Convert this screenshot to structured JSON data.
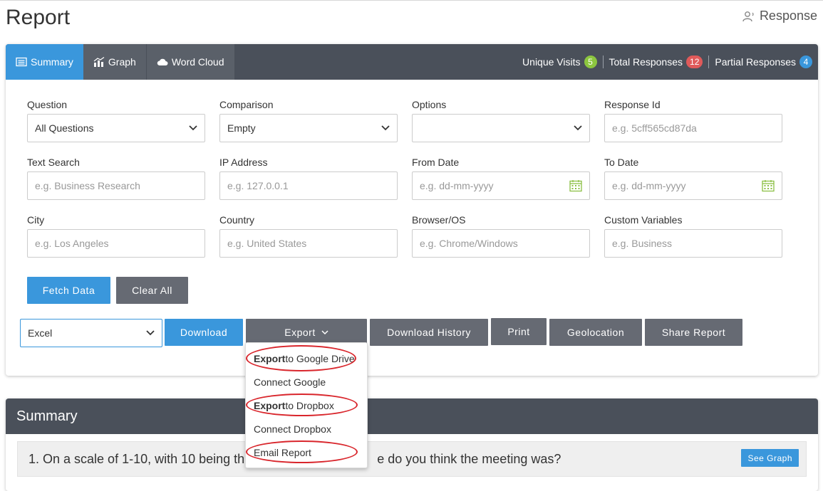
{
  "page": {
    "title": "Report",
    "response_link": "Response"
  },
  "tabs": [
    {
      "label": "Summary",
      "icon": "list-icon",
      "active": true
    },
    {
      "label": "Graph",
      "icon": "bar-chart-icon",
      "active": false
    },
    {
      "label": "Word Cloud",
      "icon": "cloud-icon",
      "active": false
    }
  ],
  "stats": {
    "unique_visits": {
      "label": "Unique Visits",
      "value": "5"
    },
    "total_responses": {
      "label": "Total Responses",
      "value": "12"
    },
    "partial_responses": {
      "label": "Partial Responses",
      "value": "4"
    }
  },
  "filters": {
    "question": {
      "label": "Question",
      "value": "All Questions"
    },
    "comparison": {
      "label": "Comparison",
      "value": "Empty"
    },
    "options": {
      "label": "Options",
      "value": ""
    },
    "response_id": {
      "label": "Response Id",
      "placeholder": "e.g. 5cff565cd87da"
    },
    "text_search": {
      "label": "Text Search",
      "placeholder": "e.g. Business Research"
    },
    "ip_address": {
      "label": "IP Address",
      "placeholder": "e.g. 127.0.0.1"
    },
    "from_date": {
      "label": "From Date",
      "placeholder": "e.g. dd-mm-yyyy"
    },
    "to_date": {
      "label": "To Date",
      "placeholder": "e.g. dd-mm-yyyy"
    },
    "city": {
      "label": "City",
      "placeholder": "e.g. Los Angeles"
    },
    "country": {
      "label": "Country",
      "placeholder": "e.g. United States"
    },
    "browser_os": {
      "label": "Browser/OS",
      "placeholder": "e.g. Chrome/Windows"
    },
    "custom_variables": {
      "label": "Custom Variables",
      "placeholder": "e.g. Business"
    }
  },
  "buttons": {
    "fetch": "Fetch Data",
    "clear": "Clear All",
    "download": "Download",
    "export": "Export",
    "download_history": "Download History",
    "print": "Print",
    "geolocation": "Geolocation",
    "share_report": "Share Report"
  },
  "format_select": {
    "value": "Excel"
  },
  "export_menu": [
    {
      "bold": "Export",
      "rest": " to Google Drive"
    },
    {
      "bold": "",
      "rest": "Connect Google"
    },
    {
      "bold": "Export",
      "rest": " to Dropbox"
    },
    {
      "bold": "",
      "rest": "Connect Dropbox"
    },
    {
      "bold": "",
      "rest": "Email Report"
    }
  ],
  "summary": {
    "title": "Summary",
    "question_text": "1. On a scale of 1-10, with 10 being the",
    "question_text_tail": "e do you think the meeting was?",
    "see_graph": "See Graph"
  },
  "colors": {
    "accent": "#3a97dc",
    "dark_bar": "#4a505a",
    "gray_button": "#666a73",
    "annotation_red": "#d9262c"
  }
}
